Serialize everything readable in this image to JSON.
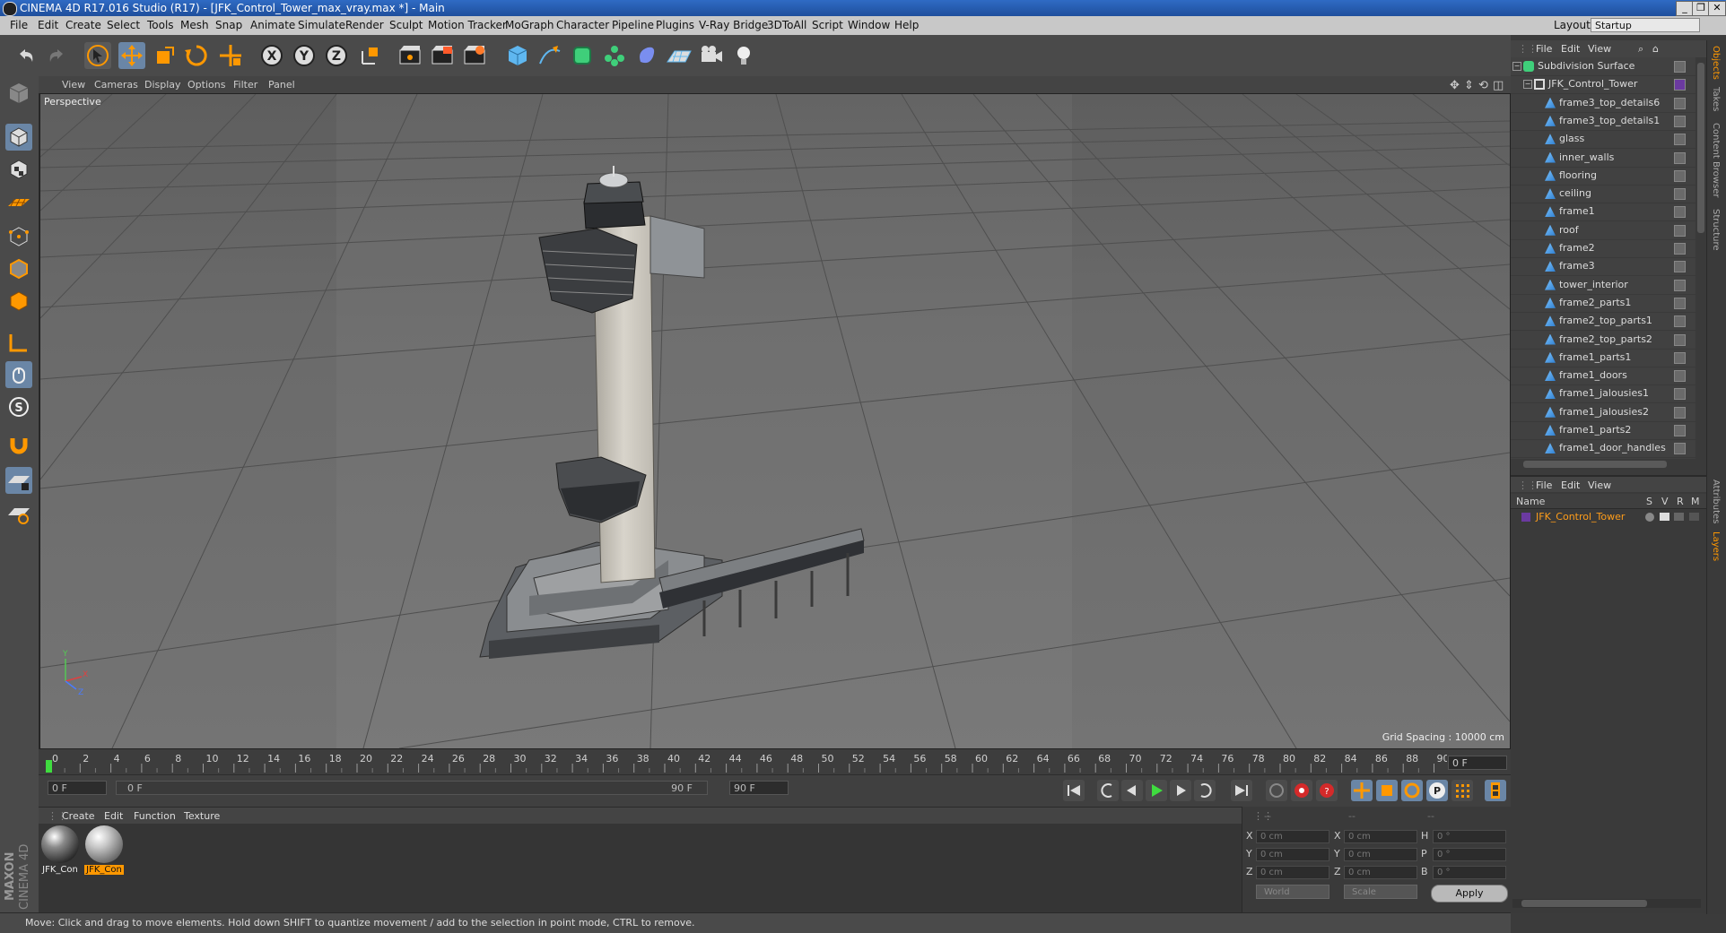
{
  "title_bar": {
    "title": "CINEMA 4D R17.016 Studio (R17) - [JFK_Control_Tower_max_vray.max *] - Main"
  },
  "menu": [
    "File",
    "Edit",
    "Create",
    "Select",
    "Tools",
    "Mesh",
    "Snap",
    "Animate",
    "Simulate",
    "Render",
    "Sculpt",
    "Motion Tracker",
    "MoGraph",
    "Character",
    "Pipeline",
    "Plugins",
    "V-Ray Bridge",
    "3DToAll",
    "Script",
    "Window",
    "Help"
  ],
  "layout": {
    "label": "Layout:",
    "value": "Startup"
  },
  "viewport": {
    "menu": [
      "View",
      "Cameras",
      "Display",
      "Options",
      "Filter",
      "Panel"
    ],
    "camera_label": "Perspective",
    "grid_spacing": "Grid Spacing : 10000 cm",
    "axis_labels": {
      "x": "X",
      "y": "Y",
      "z": "Z"
    }
  },
  "timeline": {
    "ticks": [
      "0",
      "2",
      "4",
      "6",
      "8",
      "10",
      "12",
      "14",
      "16",
      "18",
      "20",
      "22",
      "24",
      "26",
      "28",
      "30",
      "32",
      "34",
      "36",
      "38",
      "40",
      "42",
      "44",
      "46",
      "48",
      "50",
      "52",
      "54",
      "56",
      "58",
      "60",
      "62",
      "64",
      "66",
      "68",
      "70",
      "72",
      "74",
      "76",
      "78",
      "80",
      "82",
      "84",
      "86",
      "88",
      "90"
    ],
    "current_frame": "0 F",
    "start_field": "0 F",
    "range_start": "0 F",
    "range_end": "90 F",
    "end_field": "90 F"
  },
  "material_manager": {
    "menu": [
      "Create",
      "Edit",
      "Function",
      "Texture"
    ],
    "materials": [
      {
        "label": "JFK_Con",
        "selected": false
      },
      {
        "label": "JFK_Con",
        "selected": true
      }
    ]
  },
  "coordinates": {
    "headers": [
      "--",
      "--",
      "--"
    ],
    "rows": [
      {
        "l1": "X",
        "v1": "0 cm",
        "l2": "X",
        "v2": "0 cm",
        "l3": "H",
        "v3": "0 °"
      },
      {
        "l1": "Y",
        "v1": "0 cm",
        "l2": "Y",
        "v2": "0 cm",
        "l3": "P",
        "v3": "0 °"
      },
      {
        "l1": "Z",
        "v1": "0 cm",
        "l2": "Z",
        "v2": "0 cm",
        "l3": "B",
        "v3": "0 °"
      }
    ],
    "mode1": "World",
    "mode2": "Scale",
    "apply": "Apply"
  },
  "status_bar": {
    "text": "Move: Click and drag to move elements. Hold down SHIFT to quantize movement / add to the selection in point mode, CTRL to remove."
  },
  "object_manager": {
    "menu": [
      "File",
      "Edit",
      "View"
    ],
    "objects": [
      {
        "name": "Subdivision Surface",
        "depth": 0,
        "type": "subdivision"
      },
      {
        "name": "JFK_Control_Tower",
        "depth": 1,
        "type": "null"
      },
      {
        "name": "frame3_top_details6",
        "depth": 2,
        "type": "mesh"
      },
      {
        "name": "frame3_top_details1",
        "depth": 2,
        "type": "mesh"
      },
      {
        "name": "glass",
        "depth": 2,
        "type": "mesh"
      },
      {
        "name": "inner_walls",
        "depth": 2,
        "type": "mesh"
      },
      {
        "name": "flooring",
        "depth": 2,
        "type": "mesh"
      },
      {
        "name": "ceiling",
        "depth": 2,
        "type": "mesh"
      },
      {
        "name": "frame1",
        "depth": 2,
        "type": "mesh"
      },
      {
        "name": "roof",
        "depth": 2,
        "type": "mesh"
      },
      {
        "name": "frame2",
        "depth": 2,
        "type": "mesh"
      },
      {
        "name": "frame3",
        "depth": 2,
        "type": "mesh"
      },
      {
        "name": "tower_interior",
        "depth": 2,
        "type": "mesh"
      },
      {
        "name": "frame2_parts1",
        "depth": 2,
        "type": "mesh"
      },
      {
        "name": "frame2_top_parts1",
        "depth": 2,
        "type": "mesh"
      },
      {
        "name": "frame2_top_parts2",
        "depth": 2,
        "type": "mesh"
      },
      {
        "name": "frame1_parts1",
        "depth": 2,
        "type": "mesh"
      },
      {
        "name": "frame1_doors",
        "depth": 2,
        "type": "mesh"
      },
      {
        "name": "frame1_jalousies1",
        "depth": 2,
        "type": "mesh"
      },
      {
        "name": "frame1_jalousies2",
        "depth": 2,
        "type": "mesh"
      },
      {
        "name": "frame1_parts2",
        "depth": 2,
        "type": "mesh"
      },
      {
        "name": "frame1_door_handles",
        "depth": 2,
        "type": "mesh"
      }
    ]
  },
  "layer_manager": {
    "menu": [
      "File",
      "Edit",
      "View"
    ],
    "columns": {
      "name": "Name",
      "s": "S",
      "v": "V",
      "r": "R",
      "m": "M"
    },
    "layers": [
      {
        "name": "JFK_Control_Tower",
        "color": "#6b3aa0"
      }
    ]
  },
  "side_tabs": [
    "Objects",
    "Takes",
    "Content Browser",
    "Structure",
    "Attributes",
    "Layers"
  ],
  "brand": {
    "maxon": "MAXON",
    "product": "CINEMA 4D"
  },
  "colors": {
    "accent_orange": "#ff9800",
    "selection_blue": "#6a86a6",
    "layer_name": "#ff9d1a"
  }
}
